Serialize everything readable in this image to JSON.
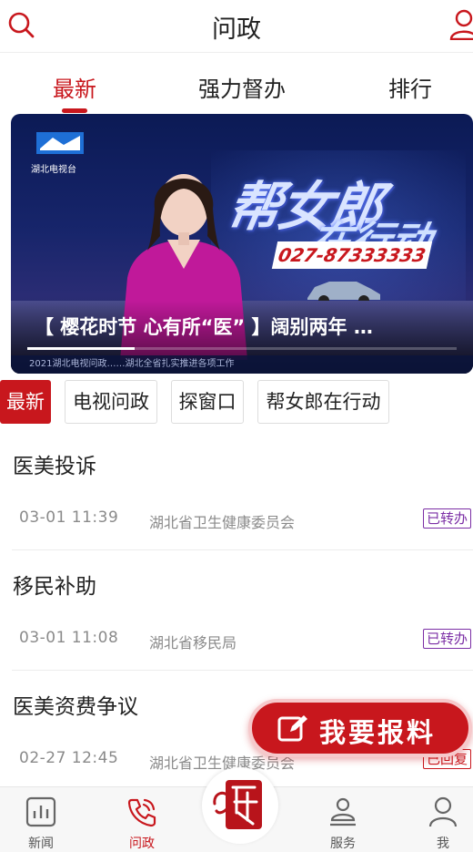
{
  "header": {
    "title": "问政",
    "search_icon": "search-icon",
    "user_icon": "user-icon"
  },
  "tabs": [
    {
      "label": "最新",
      "active": true
    },
    {
      "label": "强力督办",
      "active": false
    },
    {
      "label": "排行",
      "active": false
    }
  ],
  "banner": {
    "station_logo_text": "湖北电视台",
    "show_title": "帮女郎",
    "show_subtitle": "在行动",
    "hotline": "027-87333333",
    "caption": "【 樱花时节  心有所“医” 】阔别两年  …",
    "ticker": "2021湖北电视问政……湖北全省扎实推进各项工作",
    "progress": 0.25
  },
  "chips": [
    {
      "label": "最新",
      "active": true
    },
    {
      "label": "电视问政",
      "active": false
    },
    {
      "label": "探窗口",
      "active": false
    },
    {
      "label": "帮女郎在行动",
      "active": false
    }
  ],
  "items": [
    {
      "title": "医美投诉",
      "time": "03-01  11:39",
      "dept": "湖北省卫生健康委员会",
      "status": "已转办",
      "status_type": "forward"
    },
    {
      "title": "移民补助",
      "time": "03-01  11:08",
      "dept": "湖北省移民局",
      "status": "已转办",
      "status_type": "forward"
    },
    {
      "title": "医美资费争议",
      "time": "02-27  12:45",
      "dept": "湖北省卫生健康委员会",
      "status": "已回复",
      "status_type": "replied"
    }
  ],
  "report_button": {
    "label": "我要报料",
    "icon": "edit-icon"
  },
  "bottom_nav": [
    {
      "label": "新闻",
      "icon": "news-icon",
      "active": false
    },
    {
      "label": "问政",
      "icon": "phone-icon",
      "active": true
    },
    {
      "label": "",
      "icon": "seal-logo-icon",
      "active": false
    },
    {
      "label": "服务",
      "icon": "service-icon",
      "active": false
    },
    {
      "label": "我",
      "icon": "profile-icon",
      "active": false
    }
  ],
  "colors": {
    "brand_red": "#c8171d",
    "forward_purple": "#7b2ea5",
    "text": "#222222",
    "muted": "#8a8a8a"
  }
}
